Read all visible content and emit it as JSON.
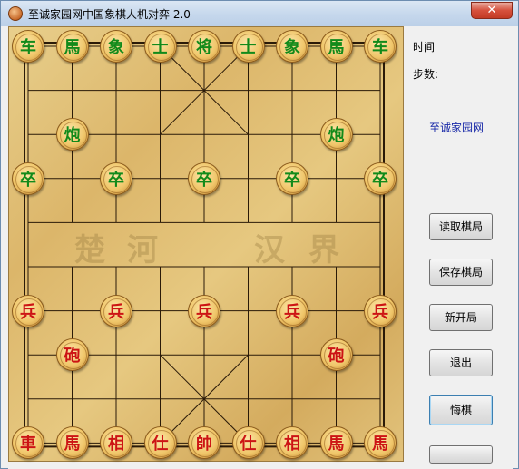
{
  "window": {
    "title": "至诚家园网中国象棋人机对弈 2.0",
    "close_label": "✕"
  },
  "board": {
    "river_left": [
      "楚",
      "河"
    ],
    "river_right": [
      "汉",
      "界"
    ],
    "pieces": [
      {
        "t": "车",
        "c": "green",
        "col": 0,
        "row": 0
      },
      {
        "t": "馬",
        "c": "green",
        "col": 1,
        "row": 0
      },
      {
        "t": "象",
        "c": "green",
        "col": 2,
        "row": 0
      },
      {
        "t": "士",
        "c": "green",
        "col": 3,
        "row": 0
      },
      {
        "t": "将",
        "c": "green",
        "col": 4,
        "row": 0
      },
      {
        "t": "士",
        "c": "green",
        "col": 5,
        "row": 0
      },
      {
        "t": "象",
        "c": "green",
        "col": 6,
        "row": 0
      },
      {
        "t": "馬",
        "c": "green",
        "col": 7,
        "row": 0
      },
      {
        "t": "车",
        "c": "green",
        "col": 8,
        "row": 0
      },
      {
        "t": "炮",
        "c": "green",
        "col": 1,
        "row": 2
      },
      {
        "t": "炮",
        "c": "green",
        "col": 7,
        "row": 2
      },
      {
        "t": "卒",
        "c": "green",
        "col": 0,
        "row": 3
      },
      {
        "t": "卒",
        "c": "green",
        "col": 2,
        "row": 3
      },
      {
        "t": "卒",
        "c": "green",
        "col": 4,
        "row": 3
      },
      {
        "t": "卒",
        "c": "green",
        "col": 6,
        "row": 3
      },
      {
        "t": "卒",
        "c": "green",
        "col": 8,
        "row": 3
      },
      {
        "t": "兵",
        "c": "red",
        "col": 0,
        "row": 6
      },
      {
        "t": "兵",
        "c": "red",
        "col": 2,
        "row": 6
      },
      {
        "t": "兵",
        "c": "red",
        "col": 4,
        "row": 6
      },
      {
        "t": "兵",
        "c": "red",
        "col": 6,
        "row": 6
      },
      {
        "t": "兵",
        "c": "red",
        "col": 8,
        "row": 6
      },
      {
        "t": "砲",
        "c": "red",
        "col": 1,
        "row": 7
      },
      {
        "t": "砲",
        "c": "red",
        "col": 7,
        "row": 7
      },
      {
        "t": "車",
        "c": "red",
        "col": 0,
        "row": 9
      },
      {
        "t": "馬",
        "c": "red",
        "col": 1,
        "row": 9
      },
      {
        "t": "相",
        "c": "red",
        "col": 2,
        "row": 9
      },
      {
        "t": "仕",
        "c": "red",
        "col": 3,
        "row": 9
      },
      {
        "t": "帥",
        "c": "red",
        "col": 4,
        "row": 9
      },
      {
        "t": "仕",
        "c": "red",
        "col": 5,
        "row": 9
      },
      {
        "t": "相",
        "c": "red",
        "col": 6,
        "row": 9
      },
      {
        "t": "馬",
        "c": "red",
        "col": 7,
        "row": 9
      },
      {
        "t": "馬",
        "c": "red",
        "col": 8,
        "row": 9
      }
    ]
  },
  "side": {
    "time_label": "时间",
    "steps_label": "步数:",
    "site_link": "至诚家园网",
    "load_button": "读取棋局",
    "save_button": "保存棋局",
    "new_button": "新开局",
    "exit_button": "退出",
    "undo_button": "悔棋"
  },
  "colors": {
    "green_piece": "#128a1a",
    "red_piece": "#cc1414",
    "link": "#1a2aa8"
  }
}
